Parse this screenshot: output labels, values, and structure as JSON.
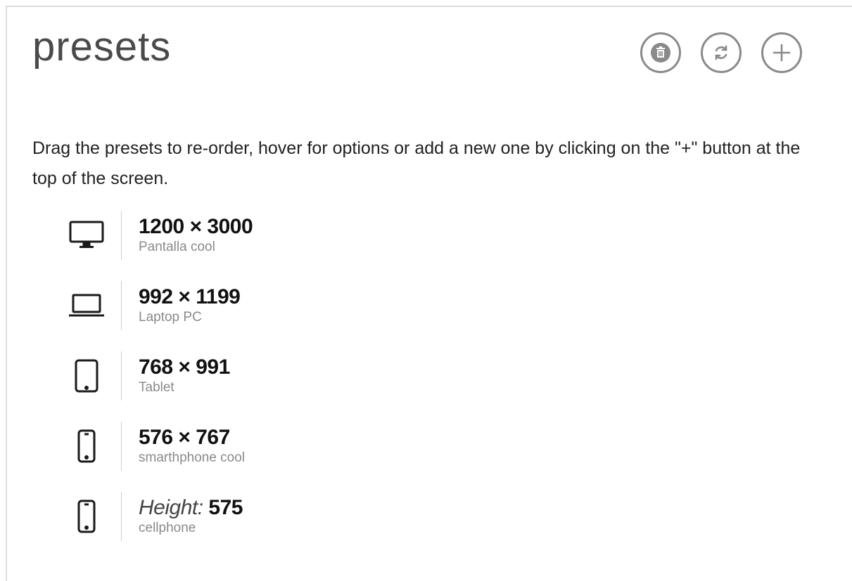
{
  "header": {
    "title": "presets",
    "actions": [
      {
        "name": "delete-button",
        "icon": "trash-icon"
      },
      {
        "name": "reset-button",
        "icon": "refresh-icon"
      },
      {
        "name": "add-button",
        "icon": "plus-icon"
      }
    ]
  },
  "help_text": "Drag the presets to re-order, hover for options or add a new one by clicking on the \"+\" button at the top of the screen.",
  "presets": [
    {
      "icon": "desktop-icon",
      "size": "1200 × 3000",
      "name": "Pantalla cool"
    },
    {
      "icon": "laptop-icon",
      "size": "992 × 1199",
      "name": "Laptop PC"
    },
    {
      "icon": "tablet-icon",
      "size": "768 × 991",
      "name": "Tablet"
    },
    {
      "icon": "smartphone-icon",
      "size": "576 × 767",
      "name": "smarthphone cool"
    },
    {
      "icon": "smartphone-icon",
      "height_label": "Height:",
      "height_value": "575",
      "name": "cellphone"
    }
  ],
  "colors": {
    "icon_border": "#8a8a8a",
    "subtext": "#8a8a8a",
    "divider": "#cfcfcf"
  }
}
